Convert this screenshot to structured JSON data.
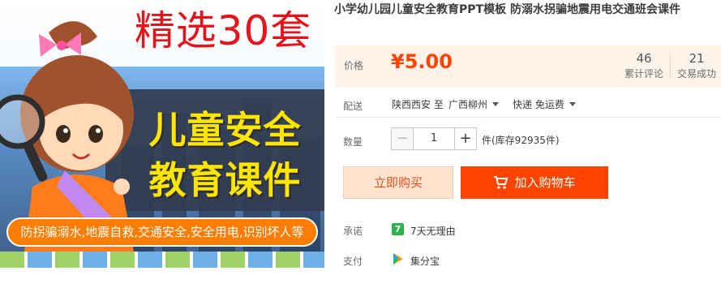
{
  "product_image": {
    "top_title": "精选30套",
    "heading_line1": "儿童安全",
    "heading_line2": "教育课件",
    "banner": "防拐骗溺水,地震自救,交通安全,安全用电,识别坏人等"
  },
  "product": {
    "title": "小学幼儿园儿童安全教育PPT模板 防溺水拐骗地震用电交通班会课件"
  },
  "price": {
    "label": "价格",
    "value": "¥5.00",
    "reviews_count": "46",
    "reviews_label": "累计评论",
    "sold_count": "21",
    "sold_label": "交易成功"
  },
  "shipping": {
    "label": "配送",
    "from": "陕西西安 至",
    "to": "广西柳州",
    "method": "快递 免运费"
  },
  "quantity": {
    "label": "数量",
    "value": "1",
    "minus": "−",
    "plus": "+",
    "stock": "件(库存92935件)"
  },
  "actions": {
    "buy_now": "立即购买",
    "add_to_cart": "加入购物车"
  },
  "promise": {
    "label": "承诺",
    "badge": "7",
    "text": "7天无理由"
  },
  "payment": {
    "label": "支付",
    "text": "集分宝"
  },
  "colors": {
    "accent": "#ff4400",
    "price": "#ff4400",
    "price_bg": "#fff2e8"
  }
}
